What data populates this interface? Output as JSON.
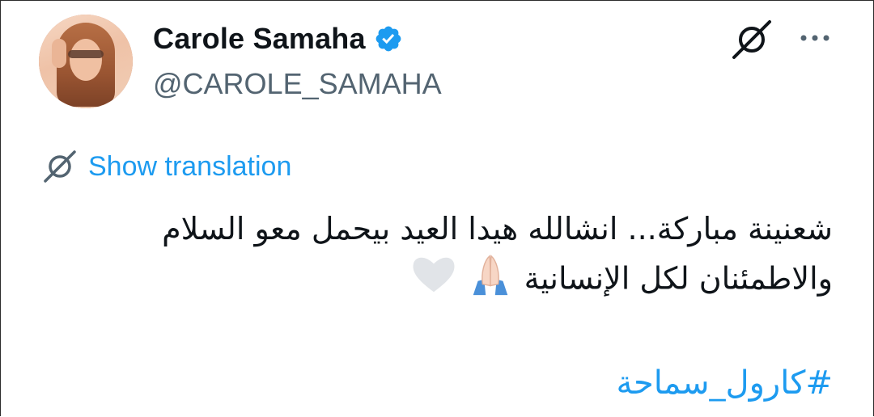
{
  "author": {
    "name": "Carole Samaha",
    "handle": "@CAROLE_SAMAHA",
    "verified": true
  },
  "translation": {
    "label": "Show translation"
  },
  "tweet": {
    "text": "شعنينة مباركة... انشالله هيدا العيد بيحمل معو السلام والاطمئنان لكل الإنسانية",
    "emojis": [
      "folded-hands-emoji",
      "white-heart-emoji"
    ],
    "hashtag": "#كارول_سماحة"
  },
  "icons": {
    "verified": "verified-badge-icon",
    "grok": "grok-icon",
    "more": "more-options-icon",
    "translate": "translate-icon"
  },
  "colors": {
    "text": "#0f1419",
    "secondary": "#536471",
    "accent": "#1d9bf0"
  }
}
